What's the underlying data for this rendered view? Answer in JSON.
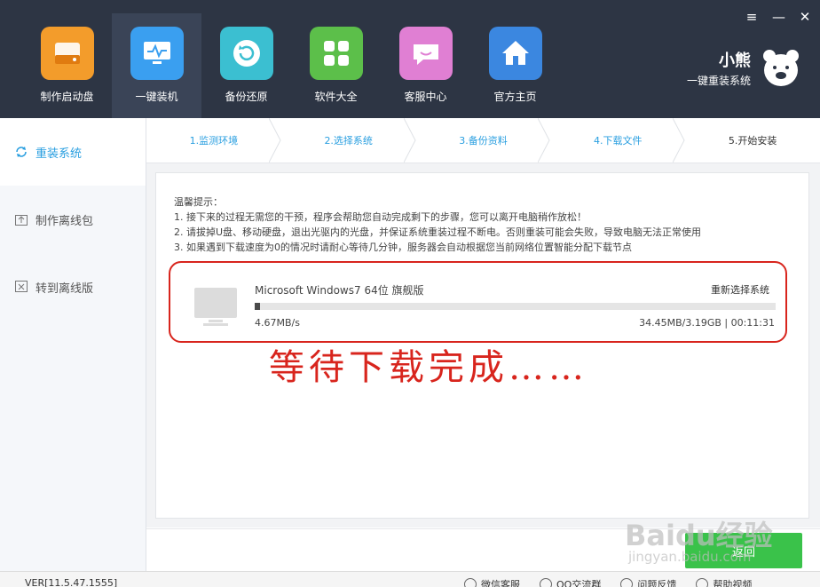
{
  "window_controls": {
    "menu": "≡",
    "minimize": "—",
    "close": "✕"
  },
  "nav": [
    {
      "label": "制作启动盘",
      "icon": "usb-drive-icon",
      "color": "#f39c2b"
    },
    {
      "label": "一键装机",
      "icon": "monitor-install-icon",
      "color": "#3a9ff0"
    },
    {
      "label": "备份还原",
      "icon": "restore-icon",
      "color": "#3bbfd1"
    },
    {
      "label": "软件大全",
      "icon": "apps-grid-icon",
      "color": "#5cbf4a"
    },
    {
      "label": "客服中心",
      "icon": "chat-icon",
      "color": "#e07fd3"
    },
    {
      "label": "官方主页",
      "icon": "home-icon",
      "color": "#3b87e0"
    }
  ],
  "brand": {
    "title": "小熊",
    "subtitle": "一键重装系统"
  },
  "sidebar": [
    {
      "label": "重装系统",
      "icon": "refresh-icon"
    },
    {
      "label": "制作离线包",
      "icon": "upload-box-icon"
    },
    {
      "label": "转到离线版",
      "icon": "offline-icon"
    }
  ],
  "steps": [
    "1.监测环境",
    "2.选择系统",
    "3.备份资料",
    "4.下载文件",
    "5.开始安装"
  ],
  "tips": {
    "title": "温馨提示：",
    "lines": [
      "1. 接下来的过程无需您的干预，程序会帮助您自动完成剩下的步骤，您可以离开电脑稍作放松！",
      "2. 请拔掉U盘、移动硬盘，退出光驱内的光盘，并保证系统重装过程不断电。否则重装可能会失败，导致电脑无法正常使用",
      "3. 如果遇到下载速度为0的情况时请耐心等待几分钟，服务器会自动根据您当前网络位置智能分配下载节点"
    ]
  },
  "download": {
    "os_name": "Microsoft Windows7 64位 旗舰版",
    "reselect": "重新选择系统",
    "speed": "4.67MB/s",
    "progress_text": "34.45MB/3.19GB | 00:11:31",
    "progress_fraction": 0.011
  },
  "annotation": "等待下载完成……",
  "back_button": "返回",
  "footer": {
    "version": "VER[11.5.47.1555]",
    "links": [
      "微信客服",
      "QQ交流群",
      "问题反馈",
      "帮助视频"
    ]
  },
  "watermark": {
    "line1": "Baidu经验",
    "line2": "jingyan.baidu.com"
  }
}
